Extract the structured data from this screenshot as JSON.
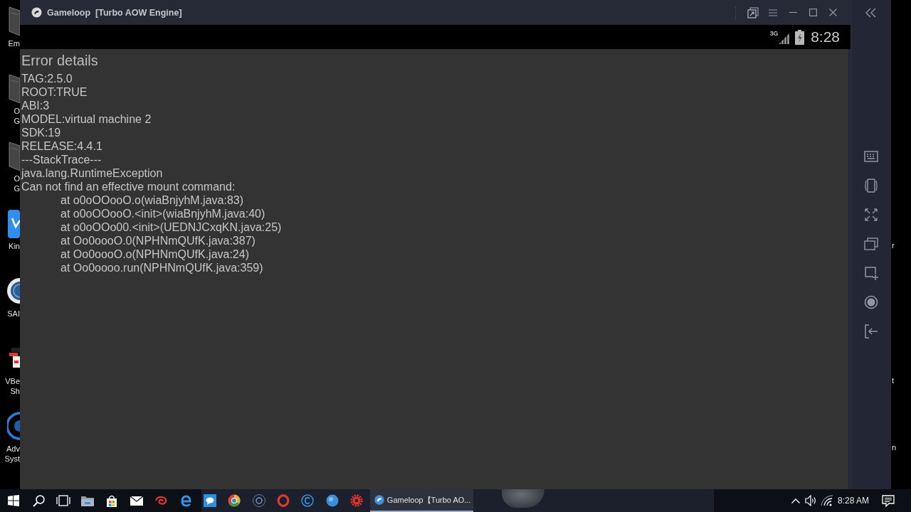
{
  "desktop": {
    "left_shortcuts": [
      {
        "kind": "file",
        "label_lines": [
          "Em"
        ]
      },
      {
        "kind": "file",
        "label_lines": [
          "O",
          "G"
        ]
      },
      {
        "kind": "file",
        "label_lines": [
          "O",
          "G"
        ]
      },
      {
        "kind": "tile",
        "label_lines": [
          "Kin"
        ]
      },
      {
        "kind": "globe",
        "label_lines": [
          "SAI"
        ]
      },
      {
        "kind": "figure",
        "label_lines": [
          "VBe",
          "Sh"
        ]
      },
      {
        "kind": "ring",
        "label_lines": [
          "Adv",
          "Syst"
        ]
      }
    ],
    "right_shortcuts": [
      {
        "label": "r"
      },
      {
        "label": "t"
      },
      {
        "label": "n"
      }
    ]
  },
  "window": {
    "title": "Gameloop  [Turbo AOW Engine]"
  },
  "status_bar": {
    "network": "3G",
    "time": "8:28"
  },
  "error_screen": {
    "heading": "Error details",
    "lines": [
      {
        "kind": "text",
        "text": "TAG:2.5.0"
      },
      {
        "kind": "text",
        "text": "ROOT:TRUE"
      },
      {
        "kind": "text",
        "text": "ABI:3"
      },
      {
        "kind": "text",
        "text": "MODEL:virtual machine 2"
      },
      {
        "kind": "text",
        "text": "SDK:19"
      },
      {
        "kind": "text",
        "text": "RELEASE:4.4.1"
      },
      {
        "kind": "text",
        "text": "---StackTrace---"
      },
      {
        "kind": "text",
        "text": "java.lang.RuntimeException"
      },
      {
        "kind": "text",
        "text": "Can not find an effective mount command:"
      },
      {
        "kind": "frame",
        "text": "at o0oOOooO.o(wiaBnjyhM.java:83)"
      },
      {
        "kind": "frame",
        "text": "at o0oOOooO.<init>(wiaBnjyhM.java:40)"
      },
      {
        "kind": "frame",
        "text": "at o0oOOo00.<init>(UEDNJCxqKN.java:25)"
      },
      {
        "kind": "frame",
        "text": "at Oo0oooO.0(NPHNmQUfK.java:387)"
      },
      {
        "kind": "frame",
        "text": "at Oo0oooO.o(NPHNmQUfK.java:24)"
      },
      {
        "kind": "frame",
        "text": "at Oo0oooo.run(NPHNmQUfK.java:359)"
      }
    ]
  },
  "taskbar": {
    "active_task": {
      "label": "Gameloop【Turbo AO...",
      "selected": true
    },
    "clock": "8:28 AM"
  }
}
